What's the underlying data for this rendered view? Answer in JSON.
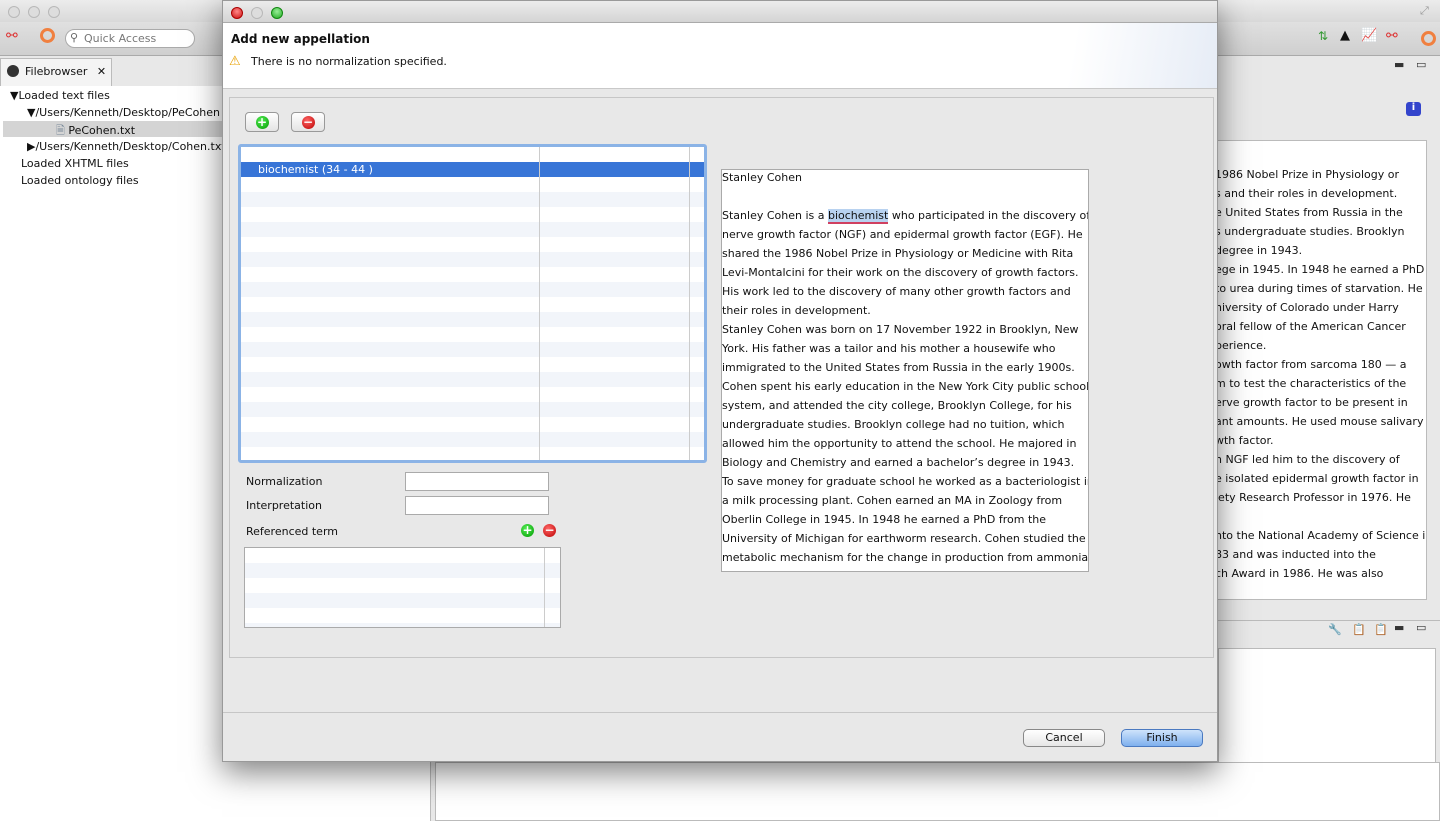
{
  "app": {
    "quick_access_placeholder": "Quick Access",
    "filebrowser_tab": "Filebrowser",
    "tree": [
      {
        "label": "Loaded text files",
        "expander": "expanded"
      },
      {
        "label": "/Users/Kenneth/Desktop/PeCohen",
        "expander": "expanded"
      },
      {
        "label": "PeCohen.txt",
        "selected": true
      },
      {
        "label": "/Users/Kenneth/Desktop/Cohen.txt",
        "expander": "collapsed"
      },
      {
        "label": "Loaded XHTML files"
      },
      {
        "label": "Loaded ontology files"
      }
    ],
    "right_text_fragments": [
      "1986 Nobel Prize in Physiology or",
      "s and their roles in development.",
      "e United States from Russia in the",
      "s undergraduate studies.  Brooklyn",
      "degree in 1943.",
      "ege in 1945.  In 1948 he earned a PhD",
      "to urea during times of starvation.  He",
      "niversity of Colorado under Harry",
      "oral fellow of the American Cancer",
      "perience.",
      "owth factor from sarcoma 180 — a",
      "m to test the characteristics of the",
      "erve growth factor to be present in",
      "ant amounts.  He used mouse salivary",
      "wth factor.",
      "n NGF led him to the discovery of",
      "e isolated epidermal growth factor in",
      "iety Research Professor in 1976.  He",
      "",
      "nto the National Academy of Science in",
      "83 and was inducted into the",
      "ch Award in 1986.  He was also"
    ]
  },
  "dialog": {
    "title": "Add new appellation",
    "warning": "There is no normalization specified.",
    "appellations": [
      {
        "label": "biochemist (34 - 44 )",
        "selected": true
      }
    ],
    "document_lines": [
      "Stanley Cohen",
      "",
      "Stanley Cohen is a |biochemist| who participated in the discovery of",
      "nerve growth factor (NGF) and epidermal growth factor (EGF).  He",
      "shared the 1986 Nobel Prize in Physiology or Medicine with Rita",
      "Levi-Montalcini for their work on the discovery of growth factors.",
      "His work led to the discovery of many other growth factors and",
      "their roles in development.",
      "Stanley Cohen was born on 17 November 1922 in Brooklyn, New",
      "York.  His father was a tailor and his mother a housewife who",
      "immigrated to the United States from Russia in the early 1900s.",
      "Cohen spent his early education in the New York City public school",
      "system, and attended the city college, Brooklyn College, for his",
      "undergraduate studies.  Brooklyn college had no tuition, which",
      "allowed him the opportunity to attend the school.   He majored in",
      "Biology and Chemistry and earned a bachelor’s degree in 1943.",
      "To save money for graduate school he worked as a bacteriologist in",
      "a milk processing plant.  Cohen earned an MA in Zoology from",
      "Oberlin College in 1945.  In 1948 he earned a PhD from the",
      "University of Michigan for earthworm research.  Cohen studied the",
      "metabolic mechanism for the change in production from ammonia"
    ],
    "normalization_label": "Normalization",
    "normalization_value": "",
    "interpretation_label": "Interpretation",
    "interpretation_value": "",
    "referenced_term_label": "Referenced term",
    "cancel": "Cancel",
    "finish": "Finish"
  },
  "colors": {
    "selection": "#3875d7",
    "highlight": "#b8d2f0",
    "focus_border": "#8bb3e6"
  }
}
